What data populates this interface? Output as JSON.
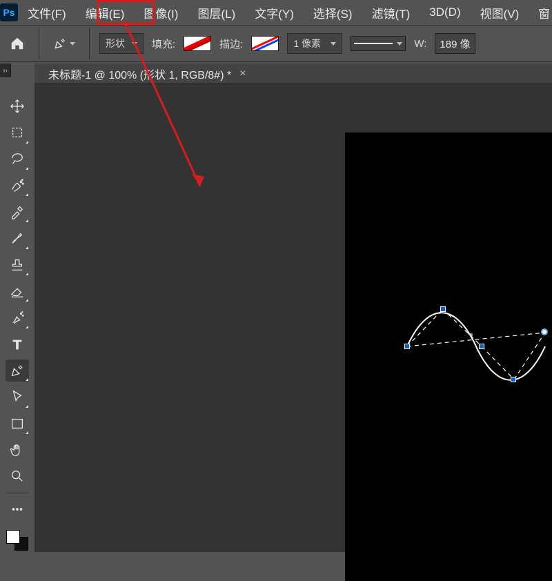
{
  "app": {
    "logo_text": "Ps"
  },
  "menu": {
    "file": "文件(F)",
    "edit": "编辑(E)",
    "image": "图像(I)",
    "layer": "图层(L)",
    "type": "文字(Y)",
    "select": "选择(S)",
    "filter": "滤镜(T)",
    "threeD": "3D(D)",
    "view": "视图(V)",
    "window_partial": "窗"
  },
  "options": {
    "mode_label": "形状",
    "fill_label": "填充:",
    "stroke_label": "描边:",
    "stroke_width": "1 像素",
    "w_label": "W:",
    "w_value": "189 像"
  },
  "tab": {
    "title": "未标题-1 @ 100% (形状 1, RGB/8#) *",
    "expander": "››"
  },
  "tools": {
    "move": "move-tool",
    "artboard": "artboard-tool",
    "lasso": "lasso-tool",
    "quickselect": "quick-selection-tool",
    "eyedropper": "eyedropper-tool",
    "brush": "brush-tool",
    "stamp": "clone-stamp-tool",
    "eraser": "eraser-tool",
    "gradient": "gradient-tool",
    "type": "type-tool",
    "pen": "pen-tool",
    "pathsel": "path-selection-tool",
    "rect": "rectangle-tool",
    "hand": "hand-tool",
    "zoom": "zoom-tool",
    "more": "edit-toolbar"
  },
  "colors": {
    "highlight": "#d81b1b",
    "anchor_blue": "#0b5ed7"
  }
}
